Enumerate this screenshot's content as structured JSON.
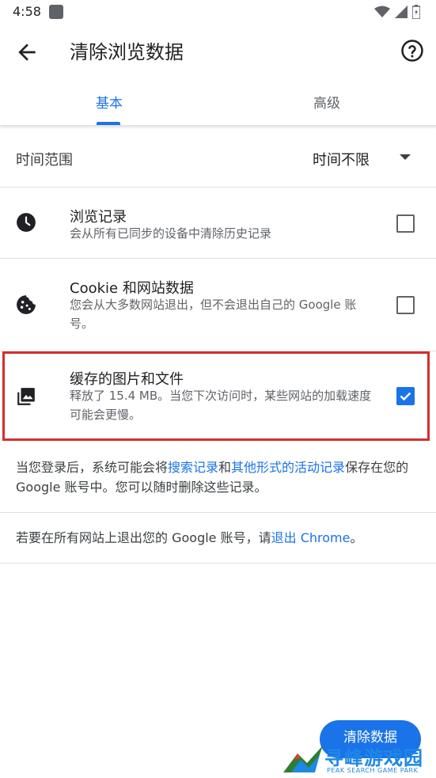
{
  "status_bar": {
    "time": "4:58"
  },
  "app_bar": {
    "title": "清除浏览数据"
  },
  "tabs": [
    {
      "label": "基本",
      "selected": true
    },
    {
      "label": "高级",
      "selected": false
    }
  ],
  "time_range": {
    "label": "时间范围",
    "value": "时间不限"
  },
  "items": [
    {
      "title": "浏览记录",
      "description": "会从所有已同步的设备中清除历史记录",
      "checked": false,
      "icon": "clock-icon"
    },
    {
      "title": "Cookie 和网站数据",
      "description": "您会从大多数网站退出，但不会退出自己的 Google 账号。",
      "checked": false,
      "icon": "cookie-icon"
    },
    {
      "title": "缓存的图片和文件",
      "description": "释放了 15.4 MB。当您下次访问时，某些网站的加载速度可能会更慢。",
      "checked": true,
      "icon": "image-icon"
    }
  ],
  "notes": {
    "signed_in": {
      "prefix": "当您登录后，系统可能会将",
      "link1": "搜索记录",
      "middle": "和",
      "link2": "其他形式的活动记录",
      "suffix": "保存在您的 Google 账号中。您可以随时删除这些记录。"
    },
    "sign_out": {
      "prefix": "若要在所有网站上退出您的 Google 账号，请",
      "link": "退出 Chrome",
      "suffix": "。"
    }
  },
  "clear_button": {
    "label": "清除数据"
  },
  "watermark": {
    "text": "寻峰游戏园",
    "subtext": "PEAK SEARCH GAME PARK"
  },
  "colors": {
    "accent": "#1a73e8",
    "highlight": "#d32f2f"
  }
}
